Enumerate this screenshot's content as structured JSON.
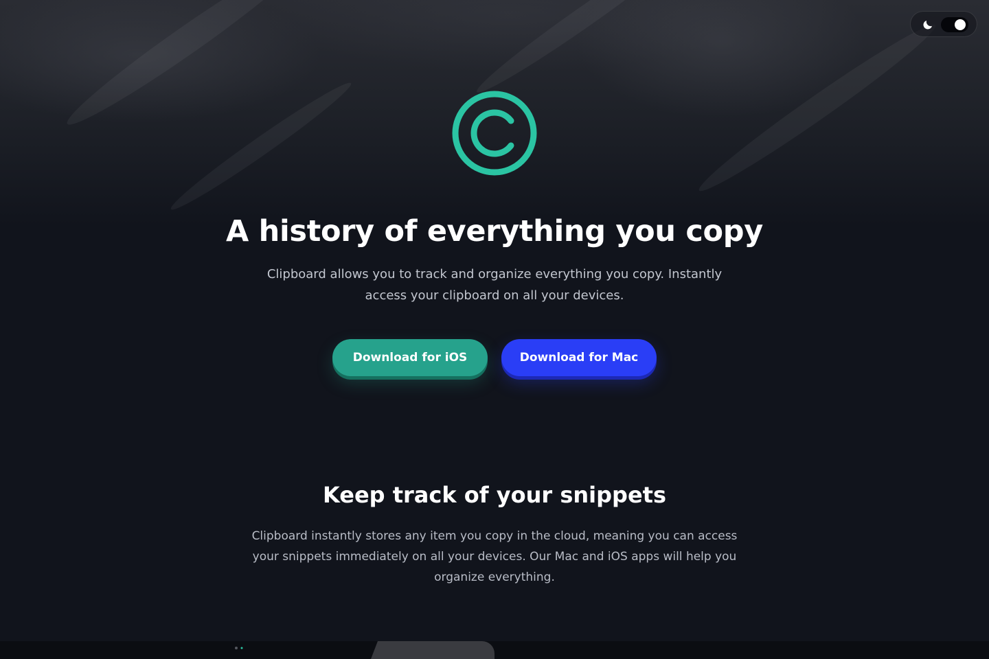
{
  "hero": {
    "title": "A history of everything you copy",
    "subtitle": "Clipboard allows you to track and organize everything you copy. Instantly access your clipboard on all your devices.",
    "buttons": {
      "ios_label": "Download for iOS",
      "mac_label": "Download for Mac"
    }
  },
  "section": {
    "title": "Keep track of your snippets",
    "text": "Clipboard instantly stores any item you copy in the cloud, meaning you can access your snippets immediately on all your devices. Our Mac and iOS apps will help you organize everything."
  },
  "theme_toggle": {
    "icon": "moon-icon",
    "state": "dark"
  },
  "logo": {
    "icon": "copyright-c-logo"
  },
  "colors": {
    "accent_teal": "#26a28c",
    "accent_blue": "#2a3ef6",
    "background": "#11141c",
    "logo": "#2bc4a3"
  }
}
